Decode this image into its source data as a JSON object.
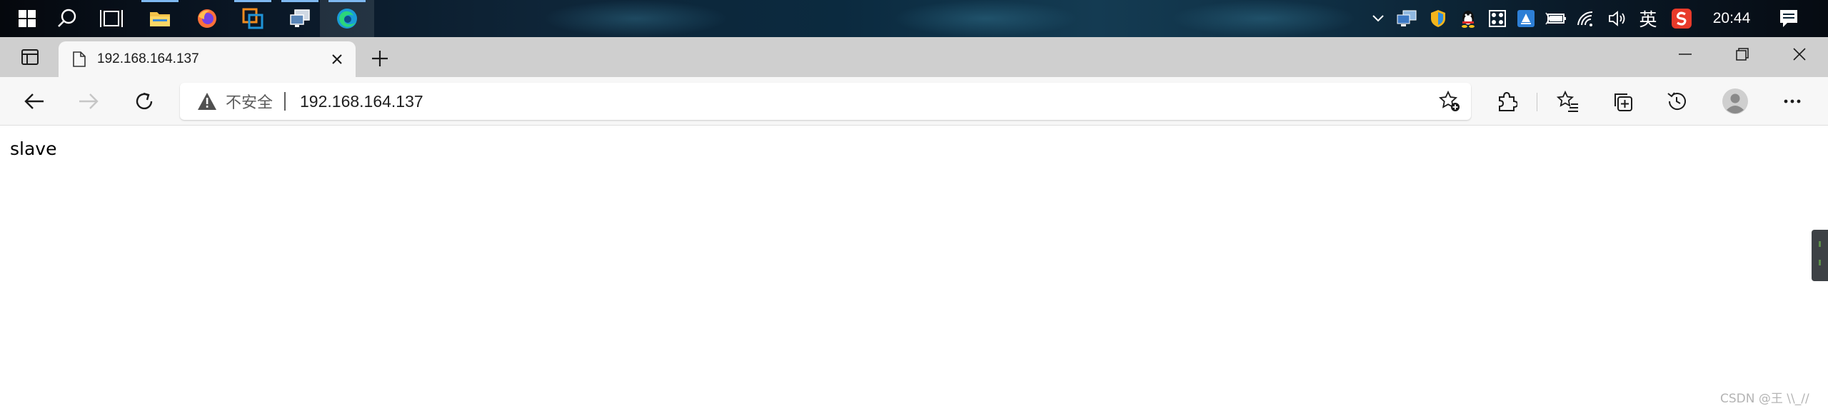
{
  "taskbar": {
    "apps": [
      {
        "name": "File Explorer",
        "icon": "folder-icon"
      },
      {
        "name": "Firefox",
        "icon": "firefox-icon"
      },
      {
        "name": "VMware Workstation",
        "icon": "vmware-icon"
      },
      {
        "name": "Remote Desktop",
        "icon": "remote-desktop-icon"
      },
      {
        "name": "Microsoft Edge",
        "icon": "edge-icon"
      }
    ],
    "ime_label": "英",
    "clock": "20:44"
  },
  "browser": {
    "tab": {
      "title": "192.168.164.137"
    },
    "address": {
      "security_label": "不安全",
      "url": "192.168.164.137"
    }
  },
  "page": {
    "body_text": "slave"
  },
  "watermark": "CSDN @王 \\\\_//",
  "colors": {
    "taskbar_dark": "#0b2233",
    "tab_strip": "#cfcfcf",
    "toolbar": "#f7f7f7",
    "accent": "#7fb8f0"
  }
}
